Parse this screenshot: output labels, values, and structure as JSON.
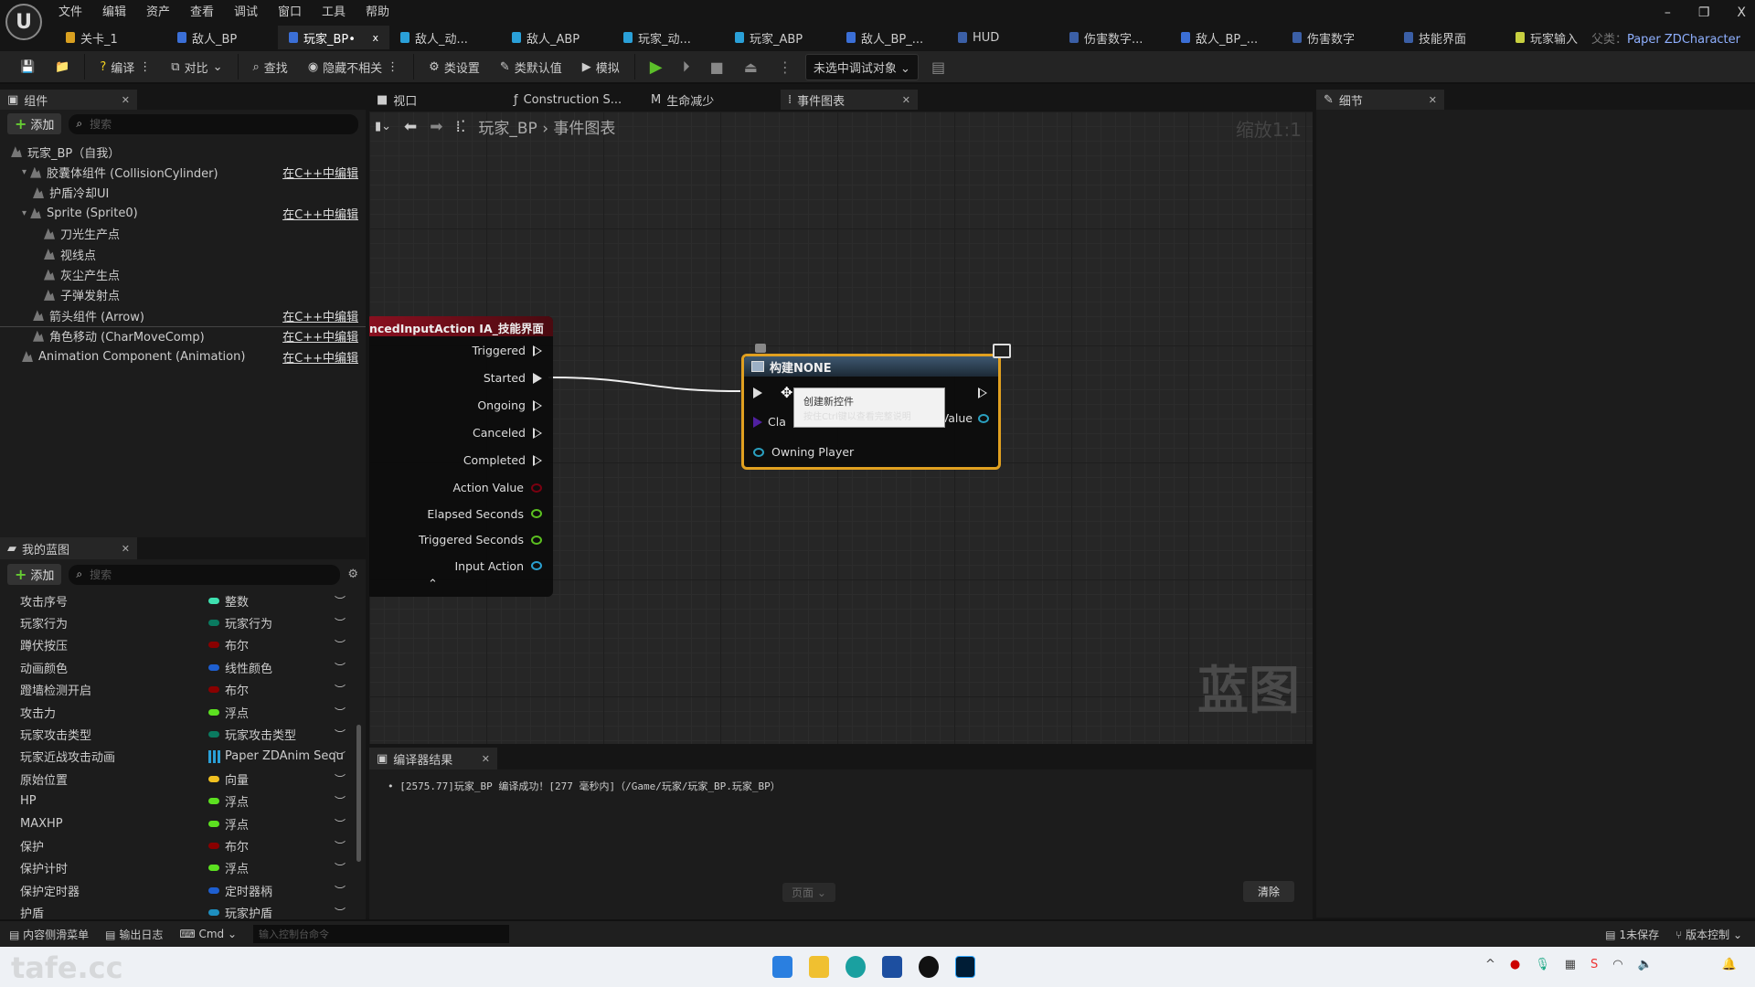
{
  "menu": [
    "文件",
    "编辑",
    "资产",
    "查看",
    "调试",
    "窗口",
    "工具",
    "帮助"
  ],
  "tabs": [
    {
      "label": "关卡_1",
      "color": "#d9a020"
    },
    {
      "label": "敌人_BP",
      "color": "#3b6fd6"
    },
    {
      "label": "玩家_BP•",
      "color": "#3b6fd6",
      "active": true
    },
    {
      "label": "敌人_动...",
      "color": "#2aa0d8"
    },
    {
      "label": "敌人_ABP",
      "color": "#2aa0d8"
    },
    {
      "label": "玩家_动...",
      "color": "#2aa0d8"
    },
    {
      "label": "玩家_ABP",
      "color": "#2aa0d8"
    },
    {
      "label": "敌人_BP_...",
      "color": "#3b6fd6"
    },
    {
      "label": "HUD",
      "color": "#3b5fa6"
    },
    {
      "label": "伤害数字...",
      "color": "#3b5fa6"
    },
    {
      "label": "敌人_BP_...",
      "color": "#3b6fd6"
    },
    {
      "label": "伤害数字",
      "color": "#3b5fa6"
    },
    {
      "label": "技能界面",
      "color": "#3b5fa6"
    },
    {
      "label": "玩家输入",
      "color": "#c8d040"
    }
  ],
  "tab_close": "x",
  "parent_label": "父类：",
  "parent_value": "Paper ZDCharacter",
  "window": {
    "min": "–",
    "max": "❐",
    "close": "X"
  },
  "toolbar": {
    "compile": "编译",
    "diff": "对比",
    "find": "查找",
    "hide": "隐藏不相关",
    "class_settings": "类设置",
    "class_defaults": "类默认值",
    "simulate": "模拟",
    "debug_target": "未选中调试对象"
  },
  "components": {
    "title": "组件",
    "add": "添加",
    "search_placeholder": "搜索",
    "items": [
      {
        "label": "玩家_BP（自我）",
        "indent": 0,
        "link": ""
      },
      {
        "label": "胶囊体组件 (CollisionCylinder)",
        "indent": 1,
        "link": "在C++中编辑",
        "arrow": "▾"
      },
      {
        "label": "护盾冷却UI",
        "indent": 2,
        "link": ""
      },
      {
        "label": "Sprite (Sprite0)",
        "indent": 1,
        "link": "在C++中编辑",
        "arrow": "▾"
      },
      {
        "label": "刀光生产点",
        "indent": 3,
        "link": ""
      },
      {
        "label": "视线点",
        "indent": 3,
        "link": ""
      },
      {
        "label": "灰尘产生点",
        "indent": 3,
        "link": ""
      },
      {
        "label": "子弹发射点",
        "indent": 3,
        "link": ""
      },
      {
        "label": "箭头组件 (Arrow)",
        "indent": 2,
        "link": "在C++中编辑"
      },
      {
        "label": "角色移动 (CharMoveComp)",
        "indent": 2,
        "link": "在C++中编辑"
      },
      {
        "label": "Animation Component (Animation)",
        "indent": 1,
        "link": "在C++中编辑"
      }
    ]
  },
  "my_blueprint": {
    "title": "我的蓝图",
    "add": "添加",
    "search_placeholder": "搜索",
    "variables": [
      {
        "name": "攻击序号",
        "type": "整数",
        "color": "#3ee0b0"
      },
      {
        "name": "玩家行为",
        "type": "玩家行为",
        "color": "#0a7a60"
      },
      {
        "name": "蹲伏按压",
        "type": "布尔",
        "color": "#8a0000"
      },
      {
        "name": "动画颜色",
        "type": "线性颜色",
        "color": "#1e5fd0"
      },
      {
        "name": "蹬墙检测开启",
        "type": "布尔",
        "color": "#8a0000"
      },
      {
        "name": "攻击力",
        "type": "浮点",
        "color": "#5ce020"
      },
      {
        "name": "玩家攻击类型",
        "type": "玩家攻击类型",
        "color": "#0a7a60"
      },
      {
        "name": "玩家近战攻击动画",
        "type": "Paper ZDAnim Sequ",
        "color": "#2aa0d8",
        "grid": true
      },
      {
        "name": "原始位置",
        "type": "向量",
        "color": "#f0c020"
      },
      {
        "name": "HP",
        "type": "浮点",
        "color": "#5ce020"
      },
      {
        "name": "MAXHP",
        "type": "浮点",
        "color": "#5ce020"
      },
      {
        "name": "保护",
        "type": "布尔",
        "color": "#8a0000"
      },
      {
        "name": "保护计时",
        "type": "浮点",
        "color": "#5ce020"
      },
      {
        "name": "保护定时器",
        "type": "定时器柄",
        "color": "#1e5fd0"
      },
      {
        "name": "护盾",
        "type": "玩家护盾",
        "color": "#1e8fc0"
      }
    ]
  },
  "graph_tabs": [
    {
      "label": "视口",
      "icon": "■"
    },
    {
      "label": "Construction S...",
      "icon": "ƒ"
    },
    {
      "label": "生命减少",
      "icon": "M"
    },
    {
      "label": "事件图表",
      "icon": "⁞",
      "active": true
    }
  ],
  "breadcrumb": {
    "root": "玩家_BP",
    "sep": "›",
    "current": "事件图表"
  },
  "zoom": "缩放1:1",
  "watermark": "蓝图",
  "input_node": {
    "title": "ncedInputAction IA_技能界面",
    "exec_pins": [
      "Triggered",
      "Started",
      "Ongoing",
      "Canceled",
      "Completed"
    ],
    "data_pins": [
      {
        "label": "Action Value",
        "color": "#7a0010"
      },
      {
        "label": "Elapsed Seconds",
        "color": "#5cc020"
      },
      {
        "label": "Triggered Seconds",
        "color": "#5cc020"
      },
      {
        "label": "Input Action",
        "color": "#2a9fd0"
      }
    ],
    "collapse": "⌃"
  },
  "construct_node": {
    "title": "构建NONE",
    "class_pin": "Cla",
    "value_pin": "Value",
    "owning_pin": "Owning Player",
    "tooltip_title": "创建新控件",
    "tooltip_sub": "按住Ctrl键以查看完整说明"
  },
  "details": {
    "title": "细节"
  },
  "compiler": {
    "title": "编译器结果",
    "message": "[2575.77]玩家_BP 编译成功！[277 毫秒内]（/Game/玩家/玩家_BP.玩家_BP）",
    "page": "页面",
    "clear": "清除"
  },
  "statusbar": {
    "content_drawer": "内容侧滑菜单",
    "output_log": "输出日志",
    "cmd": "Cmd",
    "cmd_placeholder": "输入控制台命令",
    "unsaved": "1未保存",
    "source_control": "版本控制"
  },
  "taskbar": {
    "watermark": "tafe.cc"
  }
}
